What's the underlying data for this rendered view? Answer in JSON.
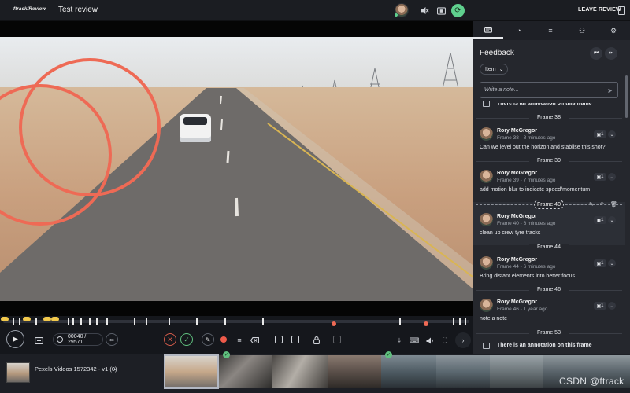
{
  "topbar": {
    "logo": "ftrack/Review",
    "title": "Test review",
    "leave_label": "LEAVE REVIEW",
    "icons": [
      "mute-icon",
      "screen-share-icon",
      "sync-icon",
      "bookmark-icon"
    ]
  },
  "player": {
    "frame_counter": "00040 / 29571"
  },
  "filmstrip": {
    "title": "Pexels Videos 1572342 - v1 (0)"
  },
  "panel": {
    "tabs": [
      "feedback-tab",
      "annotations-tab",
      "playlist-tab",
      "people-tab",
      "settings-tab"
    ],
    "title": "Feedback",
    "filter": "Item",
    "note_placeholder": "Write a note...",
    "annotation_top": "There is an annotation on this frame",
    "annotation_bottom": "There is an annotation on this frame",
    "comments": [
      {
        "frame": "Frame 38",
        "author": "Rory McGregor",
        "meta": "Frame 38 - 8 minutes ago",
        "text": "Can we level out the horizon and stablise this shot?",
        "badge": "1"
      },
      {
        "frame": "Frame 39",
        "author": "Rory McGregor",
        "meta": "Frame 39 - 7 minutes ago",
        "text": "add motion blur to indicate speed/momentum",
        "badge": "1"
      },
      {
        "frame": "Frame 40",
        "author": "Rory McGregor",
        "meta": "Frame 40 - 6 minutes ago",
        "text": "clean up crew tyre tracks",
        "badge": "1"
      },
      {
        "frame": "Frame 44",
        "author": "Rory McGregor",
        "meta": "Frame 44 - 6 minutes ago",
        "text": "Bring distant elements into better focus",
        "badge": "1"
      },
      {
        "frame": "Frame 46",
        "author": "Rory McGregor",
        "meta": "Frame 46 - 1 year ago",
        "text": "note a note",
        "badge": "1"
      }
    ],
    "last_frame": "Frame 53"
  },
  "watermark": "CSDN @ftrack",
  "colors": {
    "accent_green": "#5fd08e",
    "annotation_red": "#ee6a55",
    "marker_yellow": "#f2c94c"
  }
}
